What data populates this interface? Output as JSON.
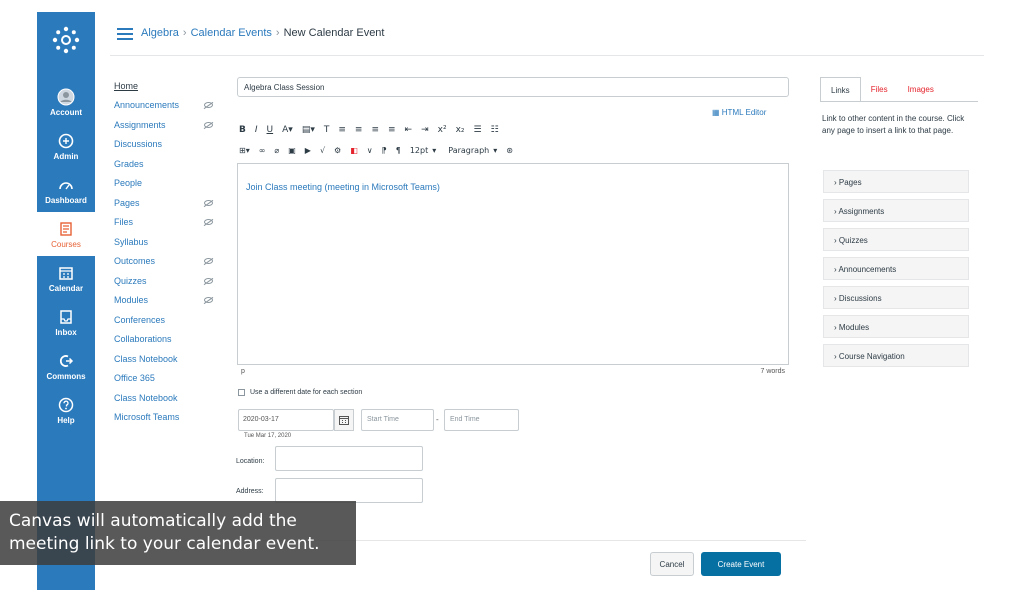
{
  "global_nav": {
    "items": [
      {
        "label": "Account",
        "icon": "user-icon"
      },
      {
        "label": "Admin",
        "icon": "shield-icon"
      },
      {
        "label": "Dashboard",
        "icon": "dashboard-icon"
      },
      {
        "label": "Courses",
        "icon": "book-icon"
      },
      {
        "label": "Calendar",
        "icon": "calendar-icon"
      },
      {
        "label": "Inbox",
        "icon": "inbox-icon"
      },
      {
        "label": "Commons",
        "icon": "commons-icon"
      },
      {
        "label": "Help",
        "icon": "help-icon"
      }
    ],
    "accent": "#2b7abc"
  },
  "breadcrumb": {
    "course": "Algebra",
    "section": "Calendar Events",
    "current": "New Calendar Event"
  },
  "course_nav": {
    "items": [
      {
        "label": "Home"
      },
      {
        "label": "Announcements"
      },
      {
        "label": "Assignments"
      },
      {
        "label": "Discussions"
      },
      {
        "label": "Grades"
      },
      {
        "label": "People"
      },
      {
        "label": "Pages"
      },
      {
        "label": "Files"
      },
      {
        "label": "Syllabus"
      },
      {
        "label": "Outcomes"
      },
      {
        "label": "Quizzes"
      },
      {
        "label": "Modules"
      },
      {
        "label": "Conferences"
      },
      {
        "label": "Collaborations"
      },
      {
        "label": "Class Notebook"
      },
      {
        "label": "Office 365"
      },
      {
        "label": "Class Notebook"
      },
      {
        "label": "Microsoft Teams"
      }
    ]
  },
  "editor": {
    "title_value": "Algebra Class Session",
    "html_editor_label": "HTML Editor",
    "font_size": "12pt",
    "paragraph": "Paragraph",
    "body_text": "Join Class meeting (meeting in Microsoft Teams)",
    "status_path": "p",
    "word_count": "7 words"
  },
  "event_form": {
    "diff_date_label": "Use a different date for each section",
    "date_value": "2020-03-17",
    "start_time_placeholder": "Start Time",
    "end_time_placeholder": "End Time",
    "date_hint": "Tue Mar 17, 2020",
    "location_label": "Location:",
    "address_label": "Address:",
    "cancel_label": "Cancel",
    "create_label": "Create Event"
  },
  "right_panel": {
    "tabs": [
      "Links",
      "Files",
      "Images"
    ],
    "description": "Link to other content in the course. Click any page to insert a link to that page.",
    "items": [
      "Pages",
      "Assignments",
      "Quizzes",
      "Announcements",
      "Discussions",
      "Modules",
      "Course Navigation"
    ]
  },
  "caption": {
    "line1": "Canvas will automatically add the",
    "line2": "meeting link to your calendar event."
  }
}
